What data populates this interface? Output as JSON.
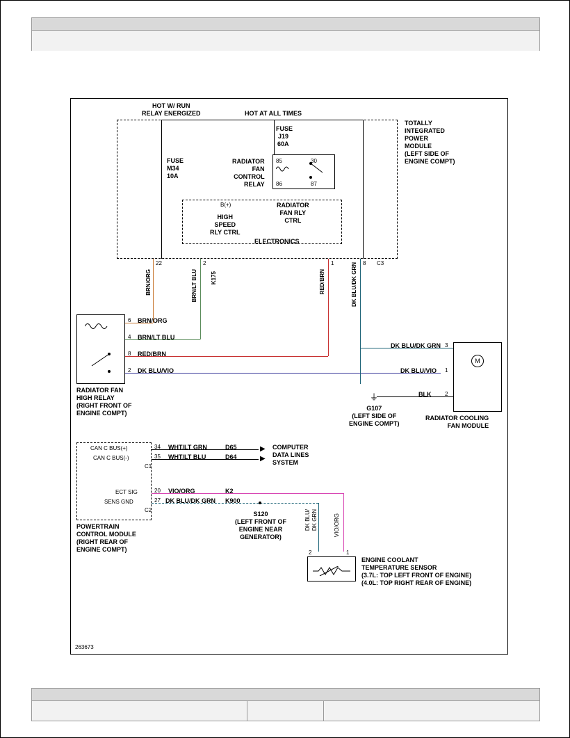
{
  "figure_id": "263673",
  "header": {
    "hot_run": "HOT W/ RUN\nRELAY ENERGIZED",
    "hot_always": "HOT AT ALL TIMES"
  },
  "tipm": {
    "label": "TOTALLY\nINTEGRATED\nPOWER\nMODULE\n(LEFT SIDE OF\nENGINE COMPT)",
    "fuse_m34": "FUSE\nM34\n10A",
    "fuse_j19": "FUSE\nJ19\n60A",
    "relay_label": "RADIATOR\nFAN\nCONTROL\nRELAY",
    "relay_pins": {
      "p85": "85",
      "p30": "30",
      "p86": "86",
      "p87": "87"
    },
    "b_plus": "B(+)",
    "hs_rly": "HIGH\nSPEED\nRLY CTRL",
    "fan_rly_ctrl": "RADIATOR\nFAN RLY\nCTRL",
    "electronics": "ELECTRONICS",
    "conn": "C3"
  },
  "wires": {
    "brn_org": "BRN/ORG",
    "brn_ltblu": "BRN/LT BLU",
    "red_brn": "RED/BRN",
    "dkblu_dkgrn": "DK BLU/DK GRN",
    "dkblu_vio": "DK BLU/VIO",
    "blk": "BLK",
    "wht_ltgrn": "WHT/LT GRN",
    "wht_ltblu": "WHT/LT BLU",
    "vio_org": "VIO/ORG",
    "dkblu_dkgrn2": "DK BLU/DK GRN"
  },
  "pins": {
    "p22": "22",
    "p2": "2",
    "p1": "1",
    "p8": "8",
    "p6": "6",
    "p4": "4",
    "p3": "3",
    "p34": "34",
    "p35": "35",
    "p20": "20",
    "p27": "27"
  },
  "codes": {
    "k175": "K175",
    "d65": "D65",
    "d64": "D64",
    "k2": "K2",
    "k900": "K900",
    "s120": "S120"
  },
  "high_relay": {
    "label": "RADIATOR FAN\nHIGH RELAY\n(RIGHT FRONT OF\nENGINE COMPT)"
  },
  "fan_module": {
    "label": "RADIATOR COOLING\nFAN MODULE",
    "motor": "M"
  },
  "ground": {
    "g107": "G107\n(LEFT SIDE OF\nENGINE COMPT)"
  },
  "pcm": {
    "can_plus": "CAN C BUS(+)",
    "can_minus": "CAN C BUS(-)",
    "ect": "ECT SIG",
    "sens_gnd": "SENS GND",
    "c1": "C1",
    "c2": "C2",
    "label": "POWERTRAIN\nCONTROL MODULE\n(RIGHT REAR OF\nENGINE COMPT)"
  },
  "datalines": "COMPUTER\nDATA LINES\nSYSTEM",
  "splice": {
    "s120": "S120\n(LEFT FRONT OF\nENGINE NEAR\nGENERATOR)"
  },
  "ect_sensor": {
    "pin_labels": {
      "dkblu_dkgrn": "DK BLU/\nDK GRN",
      "vio_org": "VIO/ORG"
    },
    "label": "ENGINE COOLANT\nTEMPERATURE SENSOR\n(3.7L: TOP LEFT FRONT OF ENGINE)\n(4.0L: TOP RIGHT REAR OF ENGINE)"
  }
}
